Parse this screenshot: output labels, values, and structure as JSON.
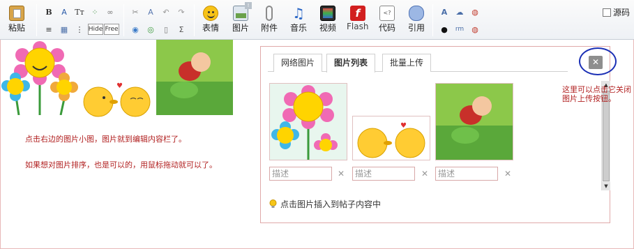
{
  "toolbar": {
    "paste_label": "粘贴",
    "small_buttons_row1": [
      "B",
      "A",
      "Tт",
      "⁘",
      "∞"
    ],
    "small_buttons_row2": [
      "≡",
      "▦",
      "⋮",
      "Hide",
      "Free"
    ],
    "emoticon_label": "表情",
    "image_label": "图片",
    "attachment_label": "附件",
    "music_label": "音乐",
    "video_label": "视频",
    "flash_label": "Flash",
    "code_label": "代码",
    "quote_label": "引用",
    "source_label": "源码"
  },
  "editor": {
    "note1": "点击右边的图片小图，图片就到编辑内容栏了。",
    "note2": "如果想对图片排序，也是可以的，用鼠标拖动就可以了。"
  },
  "popup": {
    "tabs": [
      "网络图片",
      "图片列表",
      "批量上传"
    ],
    "active_tab": "图片列表",
    "close_label": "✕",
    "desc_placeholder": "描述",
    "delete_symbol": "✕",
    "hint_text": "点击图片插入到帖子内容中"
  },
  "side_note": "这里可以点击它关闭图片上传按钮。",
  "colors": {
    "note_red": "#b22222",
    "ring_blue": "#1a2fb5",
    "popup_border": "#e0a9a9"
  }
}
